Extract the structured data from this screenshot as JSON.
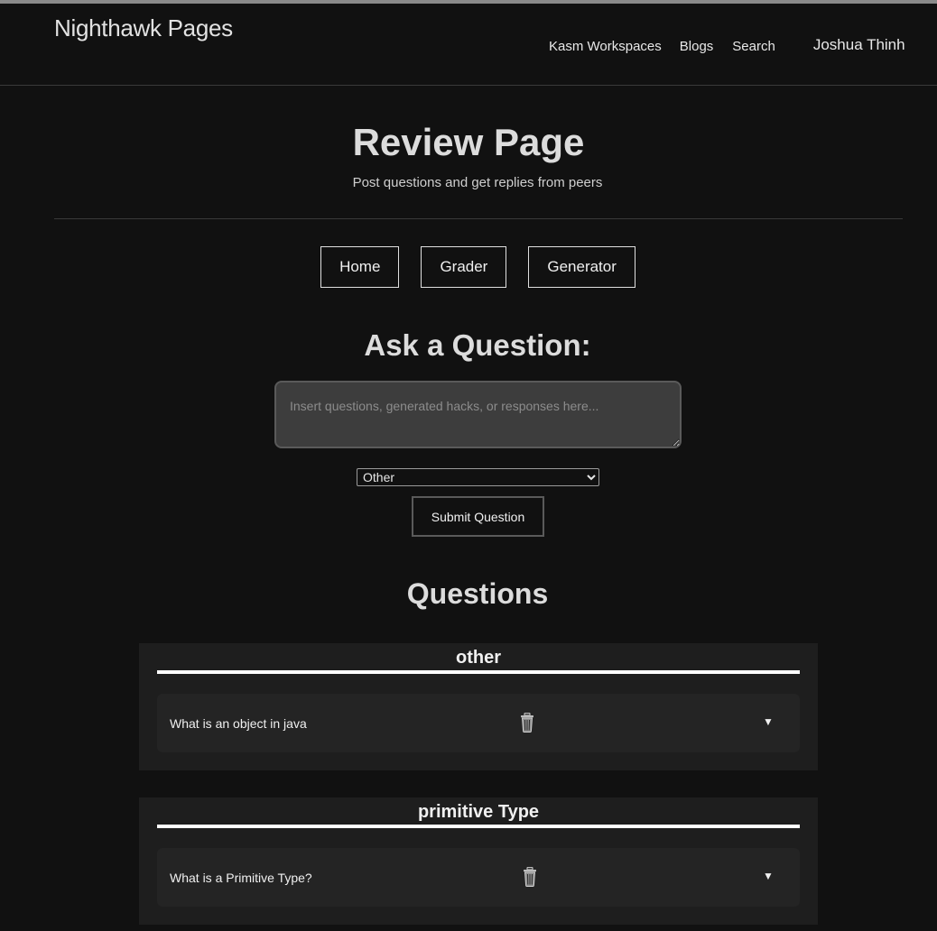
{
  "header": {
    "site_title": "Nighthawk Pages",
    "nav": {
      "kasm": "Kasm Workspaces",
      "blogs": "Blogs",
      "search": "Search",
      "user": "Joshua Thinh"
    }
  },
  "hero": {
    "title": "Review Page",
    "subtitle": "Post questions and get replies from peers"
  },
  "page_buttons": {
    "home": "Home",
    "grader": "Grader",
    "generator": "Generator"
  },
  "ask": {
    "title": "Ask a Question:",
    "placeholder": "Insert questions, generated hacks, or responses here...",
    "category_selected": "Other",
    "submit_label": "Submit Question"
  },
  "questions": {
    "title": "Questions",
    "categories": [
      {
        "name": "other",
        "items": [
          {
            "text": "What is an object in java",
            "toggle": "▼"
          }
        ]
      },
      {
        "name": "primitive Type",
        "items": [
          {
            "text": "What is a Primitive Type?",
            "toggle": "▼"
          }
        ]
      }
    ]
  },
  "icons": {
    "delete": "trash-icon",
    "expand": "chevron-down-icon"
  }
}
